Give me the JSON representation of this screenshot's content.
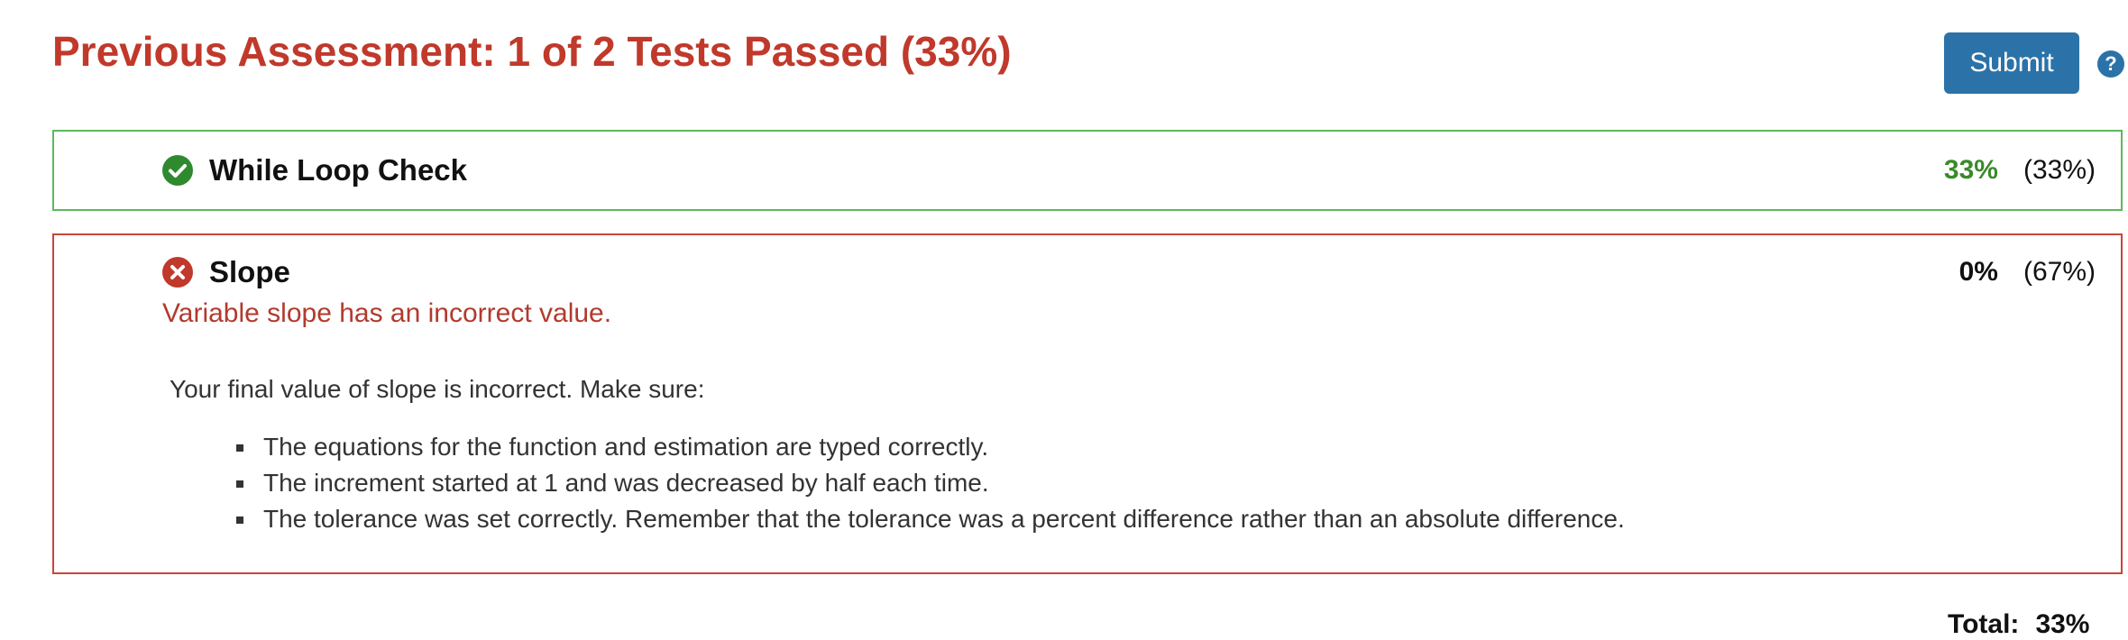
{
  "header": {
    "title": "Previous Assessment: 1 of 2 Tests Passed (33%)",
    "submit_label": "Submit",
    "help_glyph": "?",
    "accent_color": "#2b72a8",
    "title_color": "#c0392b"
  },
  "tests": [
    {
      "name": "While Loop Check",
      "status": "passed",
      "icon": "check-circle-icon",
      "score": "33%",
      "weight": "(33%)",
      "border_color": "#5cb85c"
    },
    {
      "name": "Slope",
      "status": "failed",
      "icon": "x-circle-icon",
      "score": "0%",
      "weight": "(67%)",
      "border_color": "#c9453a",
      "error": "Variable slope has an incorrect value.",
      "feedback_intro": "Your final value of slope is incorrect. Make sure:",
      "feedback_items": [
        "The equations for the function and estimation are typed correctly.",
        "The increment started at 1 and was decreased by half each time.",
        "The tolerance was set correctly. Remember that the tolerance was a percent difference rather than an absolute difference."
      ]
    }
  ],
  "total": {
    "label": "Total:",
    "value": "33%"
  }
}
